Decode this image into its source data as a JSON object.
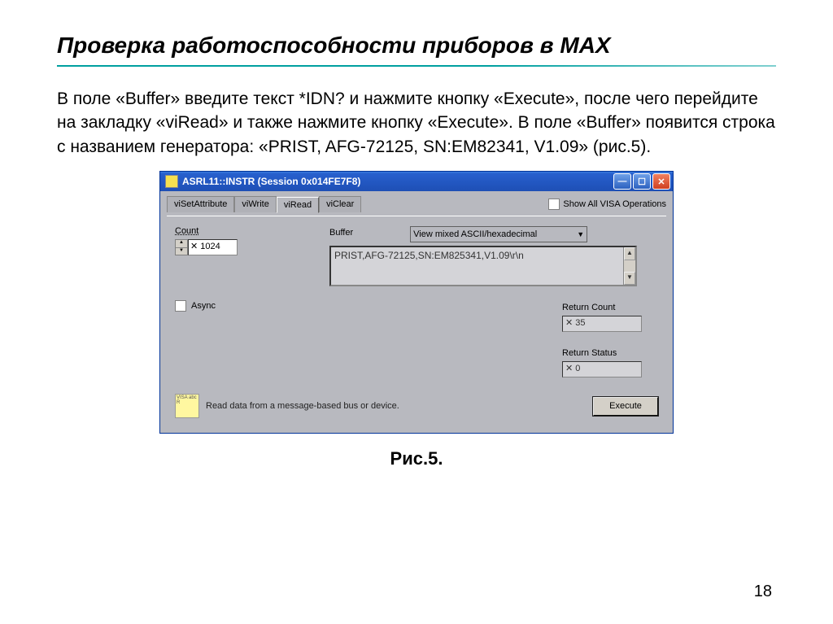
{
  "slide": {
    "title": "Проверка работоспособности  приборов в МАХ",
    "body": "В поле «Buffer» введите текст *IDN? и нажмите кнопку «Execute», после чего перейдите на закладку «viRead» и также нажмите кнопку «Execute». В поле «Buffer» появится строка с названием генератора: «PRIST, AFG-72125, SN:EM82341, V1.09» (рис.5).",
    "caption": "Рис.5.",
    "page": "18"
  },
  "window": {
    "title": "ASRL11::INSTR (Session 0x014FE7F8)",
    "tabs": [
      "viSetAttribute",
      "viWrite",
      "viRead",
      "viClear"
    ],
    "active_tab": 2,
    "show_all_label": "Show All VISA Operations",
    "count_label": "Count",
    "count_value": "✕ 1024",
    "buffer_label": "Buffer",
    "buffer_mode": "View mixed ASCII/hexadecimal",
    "buffer_text": "PRIST,AFG-72125,SN:EM825341,V1.09\\r\\n",
    "async_label": "Async",
    "return_count_label": "Return Count",
    "return_count_value": "✕ 35",
    "return_status_label": "Return Status",
    "return_status_value": "✕ 0",
    "status_text": "Read data from a message-based bus or device.",
    "execute_label": "Execute",
    "visa_badge": "VISA abc R"
  }
}
